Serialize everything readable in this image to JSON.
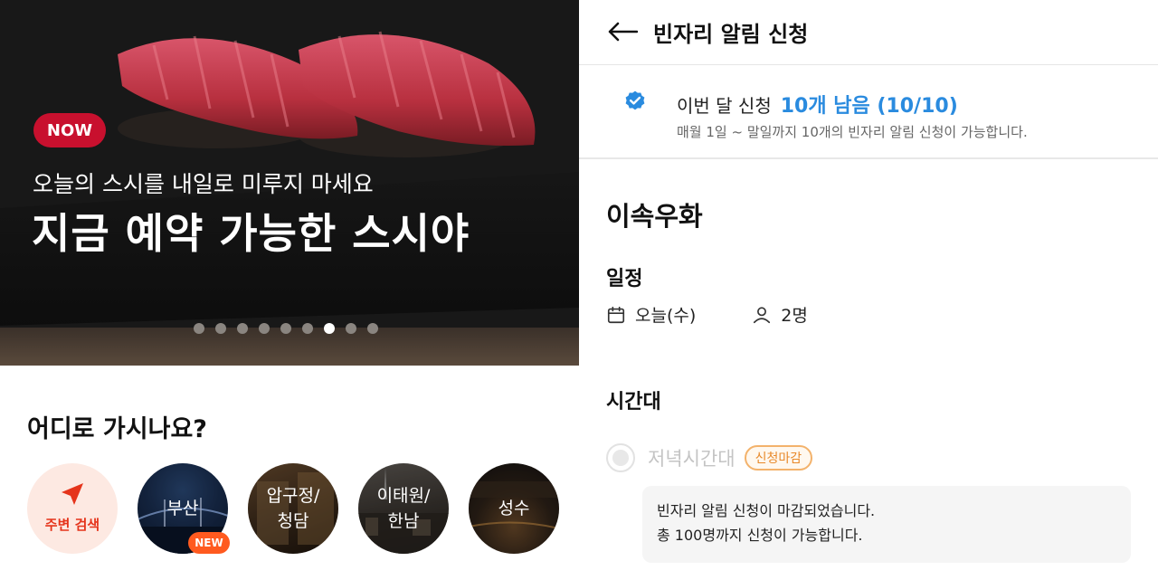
{
  "left": {
    "hero": {
      "badge": "NOW",
      "subtitle": "오늘의 스시를 내일로 미루지 마세요",
      "title": "지금 예약 가능한 스시야",
      "slides_total": 9,
      "active_slide": 7
    },
    "where": {
      "title": "어디로 가시나요?",
      "regions": [
        {
          "label": "주변 검색",
          "icon": "navigation-arrow-icon",
          "badge": ""
        },
        {
          "label": "부산",
          "badge": "NEW"
        },
        {
          "label": "압구정/\n청담",
          "badge": ""
        },
        {
          "label": "이태원/\n한남",
          "badge": ""
        },
        {
          "label": "성수",
          "badge": ""
        }
      ]
    }
  },
  "right": {
    "header": {
      "title": "빈자리 알림 신청",
      "back_icon": "arrow-left-icon"
    },
    "quota": {
      "label": "이번 달 신청",
      "count": "10개 남음 (10/10)",
      "description": "매월 1일 ~ 말일까지 10개의 빈자리 알림 신청이 가능합니다."
    },
    "restaurant_name": "이속우화",
    "schedule": {
      "label": "일정",
      "date": "오늘(수)",
      "people": "2명"
    },
    "time_slot": {
      "label": "시간대",
      "slot_name": "저녁시간대",
      "slot_status": "신청마감",
      "notice_line1": "빈자리 알림 신청이 마감되었습니다.",
      "notice_line2": "총 100명까지 신청이 가능합니다."
    }
  },
  "colors": {
    "brand_red": "#c8102e",
    "accent_blue": "#2a8bdf",
    "nearby_orange": "#e5341b",
    "closed_orange": "#e8892a"
  }
}
